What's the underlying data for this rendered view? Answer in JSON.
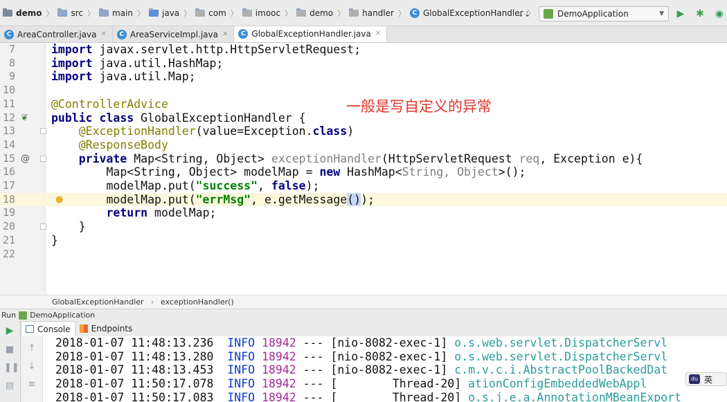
{
  "breadcrumb": [
    {
      "label": "demo",
      "icon": "project-folder-icon",
      "bold": true
    },
    {
      "label": "src",
      "icon": "folder-icon"
    },
    {
      "label": "main",
      "icon": "folder-icon"
    },
    {
      "label": "java",
      "icon": "source-folder-icon"
    },
    {
      "label": "com",
      "icon": "package-icon"
    },
    {
      "label": "imooc",
      "icon": "package-icon"
    },
    {
      "label": "demo",
      "icon": "package-icon"
    },
    {
      "label": "handler",
      "icon": "package-icon"
    },
    {
      "label": "GlobalExceptionHandler",
      "icon": "class-icon"
    }
  ],
  "run_config": {
    "label": "DemoApplication"
  },
  "tabs": [
    {
      "label": "AreaController.java",
      "active": false
    },
    {
      "label": "AreaServiceImpl.java",
      "active": false
    },
    {
      "label": "GlobalExceptionHandler.java",
      "active": true
    }
  ],
  "editor": {
    "lines": [
      {
        "num": "7"
      },
      {
        "num": "8"
      },
      {
        "num": "9"
      },
      {
        "num": "10"
      },
      {
        "num": "11"
      },
      {
        "num": "12"
      },
      {
        "num": "13"
      },
      {
        "num": "14"
      },
      {
        "num": "15"
      },
      {
        "num": "16"
      },
      {
        "num": "17"
      },
      {
        "num": "18"
      },
      {
        "num": "19"
      },
      {
        "num": "20"
      },
      {
        "num": "21"
      },
      {
        "num": "22"
      }
    ],
    "code": {
      "l7_kw": "import",
      "l7_rest": " javax.servlet.http.HttpServletRequest;",
      "l8_kw": "import",
      "l8_rest": " java.util.HashMap;",
      "l9_kw": "import",
      "l9_rest": " java.util.Map;",
      "l11_ann": "@ControllerAdvice",
      "l12_kw1": "public",
      "l12_kw2": "class",
      "l12_rest": " GlobalExceptionHandler {",
      "l13_ann": "@ExceptionHandler",
      "l13_a": "(value=Exception.",
      "l13_kw": "class",
      "l13_b": ")",
      "l14_ann": "@ResponseBody",
      "l15_kw": "private",
      "l15_a": " Map<String, Object> ",
      "l15_gray1": "exceptionHandler",
      "l15_b": "(HttpServletRequest ",
      "l15_gray2": "req",
      "l15_c": ", Exception e){",
      "l16_a": "Map<String, Object> modelMap = ",
      "l16_kw": "new",
      "l16_b": " HashMap<",
      "l16_gray": "String, Object",
      "l16_c": ">();",
      "l17_a": "modelMap.put(",
      "l17_str": "\"success\"",
      "l17_b": ", ",
      "l17_kw": "false",
      "l17_c": ");",
      "l18_a": "modelMap.put(",
      "l18_str": "\"errMsg\"",
      "l18_b": ", e.getMessage",
      "l18_p": "()",
      "l18_c": ");",
      "l19_kw": "return",
      "l19_rest": " modelMap;",
      "l20": "}",
      "l21": "}"
    },
    "overlay_text": "一般是写自定义的异常"
  },
  "method_breadcrumb": {
    "class": "GlobalExceptionHandler",
    "method": "exceptionHandler()"
  },
  "run_window": {
    "title_prefix": "Run",
    "title": "DemoApplication",
    "tabs": [
      {
        "label": "Console"
      },
      {
        "label": "Endpoints"
      }
    ],
    "logs": [
      {
        "time": "2018-01-07 11:48:13.236",
        "level": "INFO",
        "pid": "18942",
        "sep": "---",
        "thread": "[nio-8082-exec-1]",
        "logger": "o.s.web.servlet.DispatcherServl"
      },
      {
        "time": "2018-01-07 11:48:13.280",
        "level": "INFO",
        "pid": "18942",
        "sep": "---",
        "thread": "[nio-8082-exec-1]",
        "logger": "o.s.web.servlet.DispatcherServl"
      },
      {
        "time": "2018-01-07 11:48:13.453",
        "level": "INFO",
        "pid": "18942",
        "sep": "---",
        "thread": "[nio-8082-exec-1]",
        "logger": "c.m.v.c.i.AbstractPoolBackedDat"
      },
      {
        "time": "2018-01-07 11:50:17.078",
        "level": "INFO",
        "pid": "18942",
        "sep": "---",
        "thread": "[        Thread-20]",
        "logger": "ationConfigEmbeddedWebAppl"
      },
      {
        "time": "2018-01-07 11:50:17.083",
        "level": "INFO",
        "pid": "18942",
        "sep": "---",
        "thread": "[        Thread-20]",
        "logger": "o.s.j.e.a.AnnotationMBeanExport"
      }
    ]
  },
  "ime": {
    "badge": "du",
    "label": "英"
  }
}
